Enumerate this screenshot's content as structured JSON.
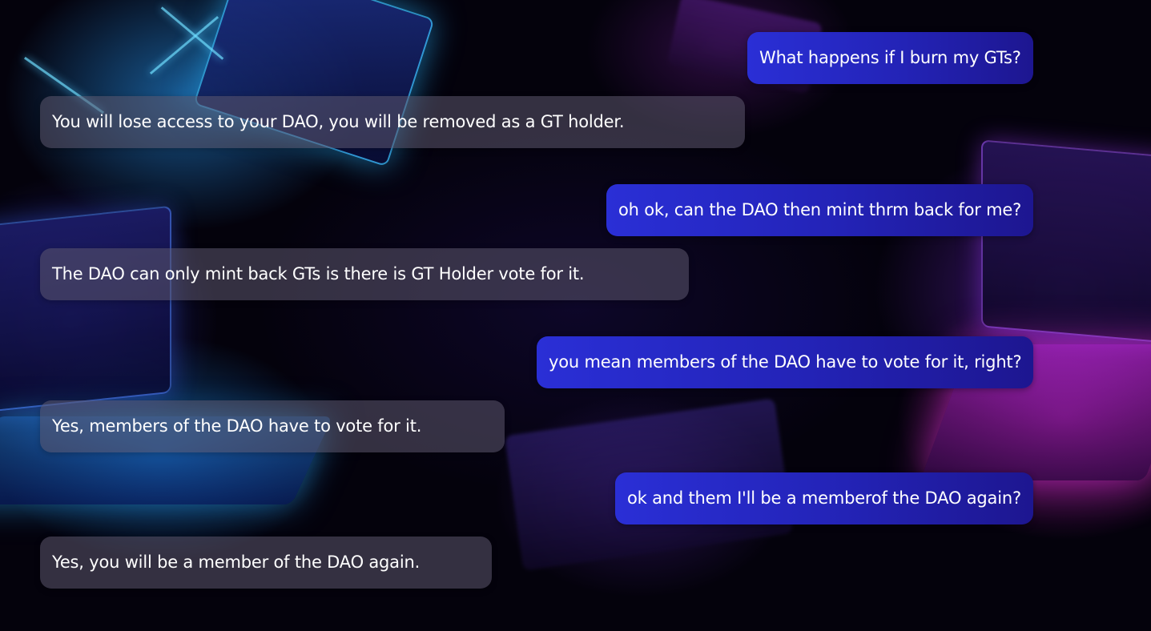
{
  "chat": {
    "messages": [
      {
        "role": "user",
        "text": "What happens if I burn my GTs?"
      },
      {
        "role": "bot",
        "text": "You will lose access to your DAO, you will be removed as a GT holder."
      },
      {
        "role": "user",
        "text": "oh ok, can the DAO then mint thrm back for me?"
      },
      {
        "role": "bot",
        "text": "The DAO can only mint back GTs is there is GT Holder vote for it."
      },
      {
        "role": "user",
        "text": "you mean members of the DAO have to vote for it, right?"
      },
      {
        "role": "bot",
        "text": "Yes, members of the DAO have to vote for it."
      },
      {
        "role": "user",
        "text": "ok and them I'll be a memberof the DAO again?"
      },
      {
        "role": "bot",
        "text": "Yes, you will be a member of the DAO again."
      }
    ]
  },
  "colors": {
    "user_bubble": "#2a2fd6",
    "bot_bubble": "#5c586e",
    "text": "#ffffff"
  }
}
